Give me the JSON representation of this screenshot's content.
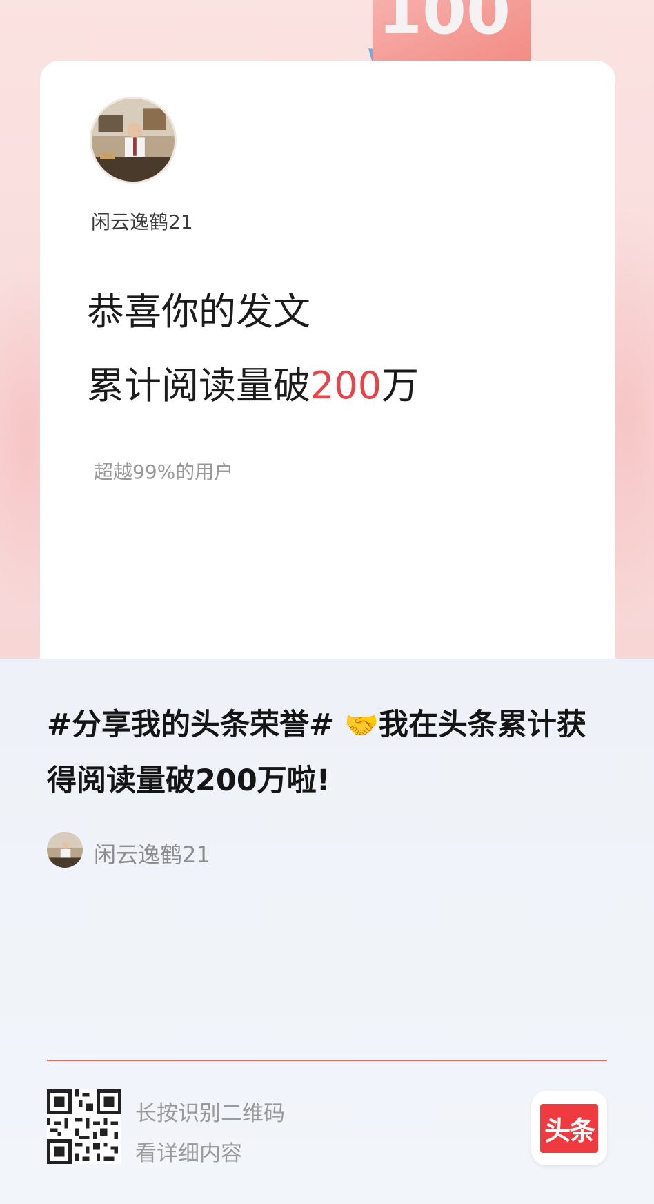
{
  "card": {
    "username": "闲云逸鹤21",
    "headline_line1": "恭喜你的发文",
    "headline_line2_prefix": "累计阅读量破",
    "headline_line2_number": "200",
    "headline_line2_suffix": "万",
    "rank_text": "超越99%的用户",
    "badge_number": "100"
  },
  "post": {
    "text_before_emoji": "#分享我的头条荣誉# ",
    "emoji": "🤝",
    "text_after_emoji": "我在头条累计获得阅读量破200万啦!",
    "author": "闲云逸鹤21"
  },
  "footer": {
    "scan_line1": "长按识别二维码",
    "scan_line2": "看详细内容",
    "app_logo_text": "头条"
  },
  "colors": {
    "accent_red": "#e84346",
    "logo_red": "#ef3b3f",
    "divider": "#e66a5e"
  },
  "icons": {
    "avatar": "user-avatar",
    "qr": "qr-code-icon",
    "logo": "toutiao-logo"
  }
}
